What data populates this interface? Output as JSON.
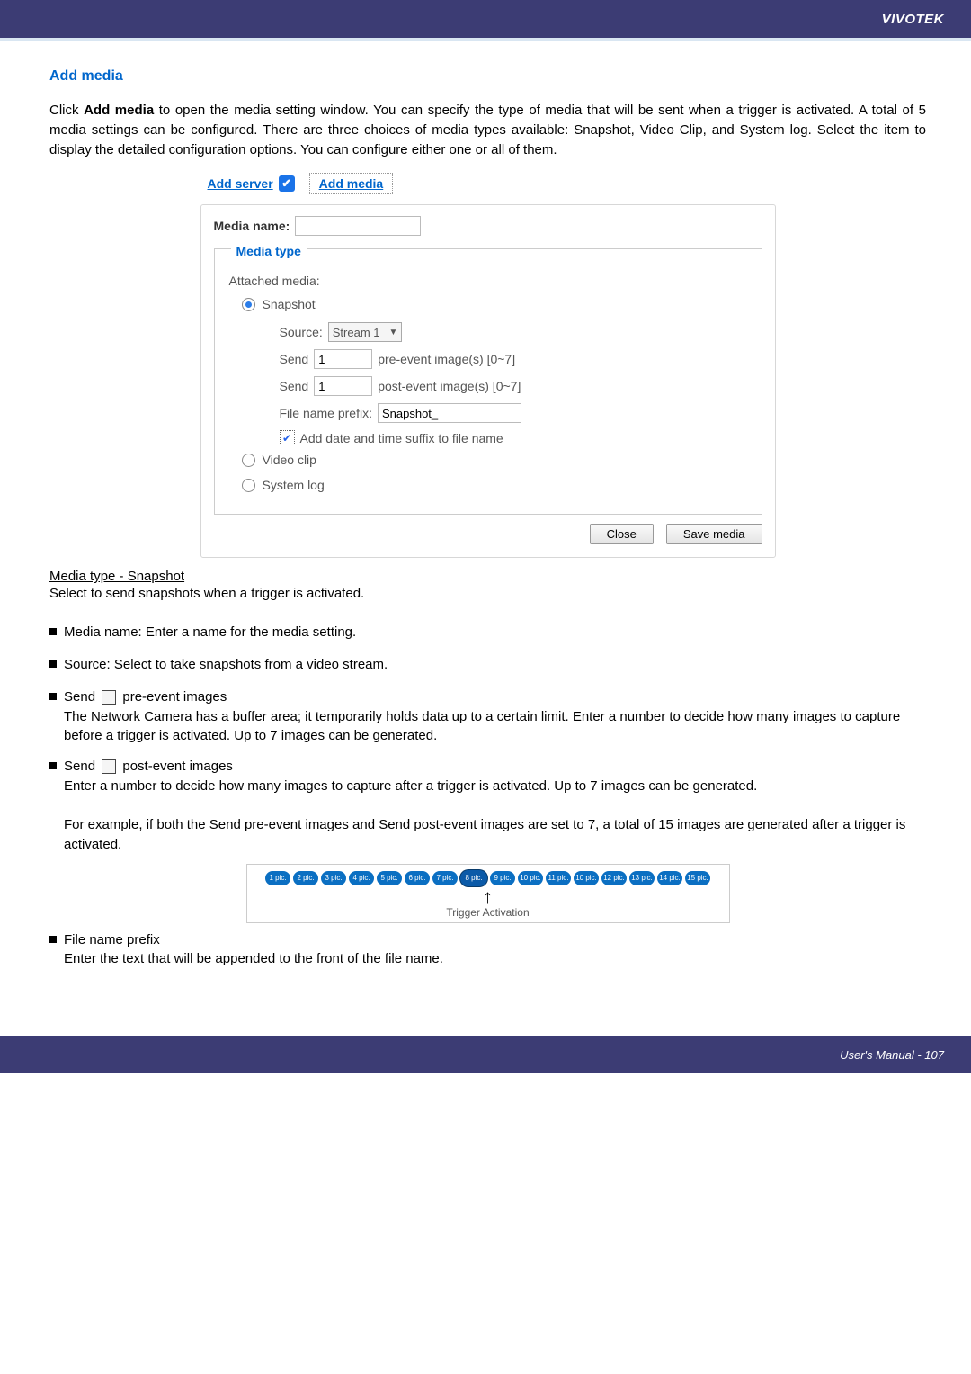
{
  "header": {
    "brand": "VIVOTEK"
  },
  "section": {
    "title": "Add media",
    "intro_prefix": "Click ",
    "intro_bold": "Add media",
    "intro_rest": " to open the media setting window. You can specify the type of media that will be sent when a trigger is activated. A total of 5 media settings can be configured. There are three choices of media types available: Snapshot, Video Clip, and System log. Select the item to display the detailed configuration options. You can configure either one or all of them."
  },
  "screenshot": {
    "add_server": "Add server",
    "add_media": "Add media",
    "media_name_label": "Media name:",
    "media_name_value": "",
    "media_type_title": "Media type",
    "attached_media": "Attached media:",
    "snapshot": "Snapshot",
    "source_label": "Source:",
    "source_value": "Stream 1",
    "send_label": "Send",
    "pre_value": "1",
    "pre_suffix": "pre-event image(s) [0~7]",
    "post_value": "1",
    "post_suffix": "post-event image(s) [0~7]",
    "prefix_label": "File name prefix:",
    "prefix_value": "Snapshot_",
    "date_suffix": "Add date and time suffix to file name",
    "video_clip": "Video clip",
    "system_log": "System log",
    "close": "Close",
    "save": "Save media"
  },
  "sub": {
    "title": "Media type - Snapshot",
    "desc": "Select to send snapshots when a trigger is activated."
  },
  "bullets": {
    "b1": "Media name: Enter a name for the media setting.",
    "b2": "Source: Select to take snapshots from a video stream.",
    "b3_lead": "Send ",
    "b3_tail": " pre-event images",
    "b3_p": "The Network Camera has a buffer area; it temporarily holds data up to a certain limit. Enter a number to decide how many images to capture before a trigger is activated. Up to 7 images can be generated.",
    "b4_lead": "Send ",
    "b4_tail": " post-event images",
    "b4_p1": "Enter a number to decide how many images to capture after a trigger is activated. Up to 7 images can be generated.",
    "b4_p2": "For example, if both the Send pre-event images and Send post-event images are set to 7, a total of 15 images are generated after a trigger is activated.",
    "b5_title": "File name prefix",
    "b5_p": "Enter the text that will be appended to the front of the file name."
  },
  "trigger_fig": {
    "pics": [
      "1 pic.",
      "2 pic.",
      "3 pic.",
      "4 pic.",
      "5 pic.",
      "6 pic.",
      "7 pic.",
      "8 pic.",
      "9 pic.",
      "10 pic.",
      "11 pic.",
      "10 pic.",
      "12 pic.",
      "13 pic.",
      "14 pic.",
      "15 pic."
    ],
    "label": "Trigger Activation"
  },
  "footer": {
    "text": "User's Manual - 107"
  }
}
